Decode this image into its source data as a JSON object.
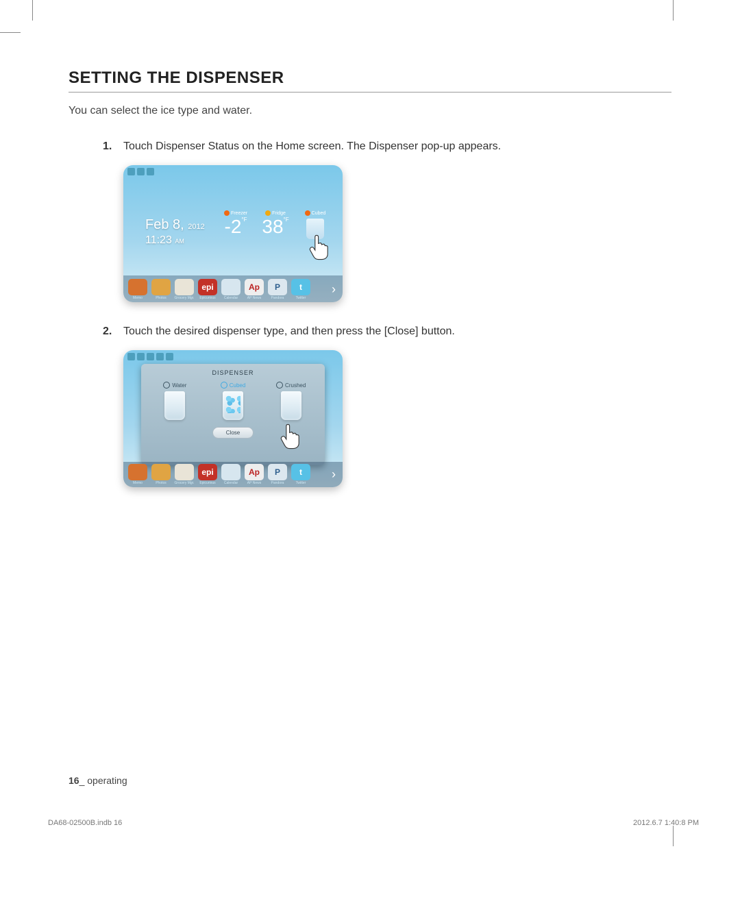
{
  "section_title": "SETTING THE DISPENSER",
  "intro": "You can select the ice type and water.",
  "steps": [
    {
      "num": "1.",
      "text": "Touch Dispenser Status on the Home screen. The Dispenser pop-up appears."
    },
    {
      "num": "2.",
      "text": "Touch the desired dispenser type, and then press the [Close] button."
    }
  ],
  "screenshot1": {
    "date_line": "Feb 8,",
    "date_year": "2012",
    "time": "11:23",
    "ampm": "AM",
    "freezer_label": "Freezer",
    "freezer_temp": "-2",
    "freezer_unit": "°F",
    "fridge_label": "Fridge",
    "fridge_temp": "38",
    "fridge_unit": "°F",
    "cubed_label": "Cubed",
    "dock": [
      "Memo",
      "Photos",
      "Grocery Mgr.",
      "Epicurious",
      "Calendar",
      "AP News",
      "Pandora",
      "Twitter"
    ]
  },
  "screenshot2": {
    "title": "DISPENSER",
    "options": [
      {
        "label": "Water",
        "selected": false
      },
      {
        "label": "Cubed",
        "selected": true
      },
      {
        "label": "Crushed",
        "selected": false
      }
    ],
    "close_label": "Close",
    "dock": [
      "Memo",
      "Photos",
      "Grocery Mgr.",
      "Epicurious",
      "Calendar",
      "AP News",
      "Pandora",
      "Twitter"
    ]
  },
  "footer": {
    "page_num": "16",
    "section": "_ operating"
  },
  "print": {
    "file": "DA68-02500B.indb   16",
    "timestamp": "2012.6.7   1:40:8 PM"
  },
  "dock_colors": [
    "#d6722f",
    "#e0a443",
    "#e9e4d7",
    "#c33127",
    "#d7e6ef",
    "#c23127",
    "#2f5f8e",
    "#57c1e6"
  ]
}
